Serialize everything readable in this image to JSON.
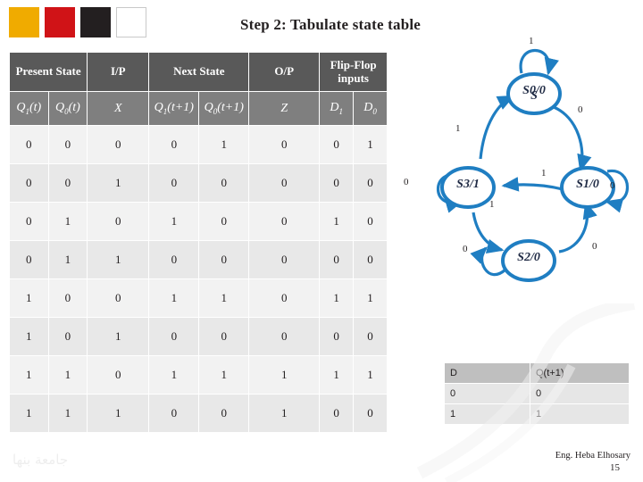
{
  "slide": {
    "title": "Step 2: Tabulate state table",
    "footer_author": "Eng. Heba Elhosary",
    "page_number": "15",
    "watermark": "جامعة بنها"
  },
  "chips": [
    {
      "name": "chip-yellow",
      "color": "#f0ab00"
    },
    {
      "name": "chip-red",
      "color": "#d01317"
    },
    {
      "name": "chip-black",
      "color": "#231f20"
    },
    {
      "name": "chip-outline",
      "color": "#ffffff"
    }
  ],
  "state_table": {
    "headers": [
      {
        "label": "Present State",
        "colspan": 2
      },
      {
        "label": "I/P",
        "colspan": 1
      },
      {
        "label": "Next State",
        "colspan": 2
      },
      {
        "label": "O/P",
        "colspan": 1
      },
      {
        "label": "Flip-Flop inputs",
        "colspan": 2
      }
    ],
    "subheaders": [
      "Q1(t)",
      "Q0(t)",
      "X",
      "Q1(t+1)",
      "Q0(t+1)",
      "Z",
      "D1",
      "D0"
    ],
    "rows": [
      [
        "0",
        "0",
        "0",
        "0",
        "1",
        "0",
        "0",
        "1"
      ],
      [
        "0",
        "0",
        "1",
        "0",
        "0",
        "0",
        "0",
        "0"
      ],
      [
        "0",
        "1",
        "0",
        "1",
        "0",
        "0",
        "1",
        "0"
      ],
      [
        "0",
        "1",
        "1",
        "0",
        "0",
        "0",
        "0",
        "0"
      ],
      [
        "1",
        "0",
        "0",
        "1",
        "1",
        "0",
        "1",
        "1"
      ],
      [
        "1",
        "0",
        "1",
        "0",
        "0",
        "0",
        "0",
        "0"
      ],
      [
        "1",
        "1",
        "0",
        "1",
        "1",
        "1",
        "1",
        "1"
      ],
      [
        "1",
        "1",
        "1",
        "0",
        "0",
        "1",
        "0",
        "0"
      ]
    ]
  },
  "d_table": {
    "headers": [
      "D",
      "Q(t+1)"
    ],
    "rows": [
      [
        "0",
        "0"
      ],
      [
        "1",
        "1"
      ]
    ]
  },
  "state_diagram": {
    "accent_color": "#1f7ec2",
    "nodes": [
      {
        "id": "s0",
        "label": "S0/0"
      },
      {
        "id": "s1",
        "label": "S1/0"
      },
      {
        "id": "s2",
        "label": "S2/0"
      },
      {
        "id": "s3",
        "label": "S3/1"
      }
    ],
    "edge_labels": [
      "1",
      "0",
      "1",
      "0",
      "1",
      "1",
      "0",
      "0",
      "0"
    ]
  }
}
